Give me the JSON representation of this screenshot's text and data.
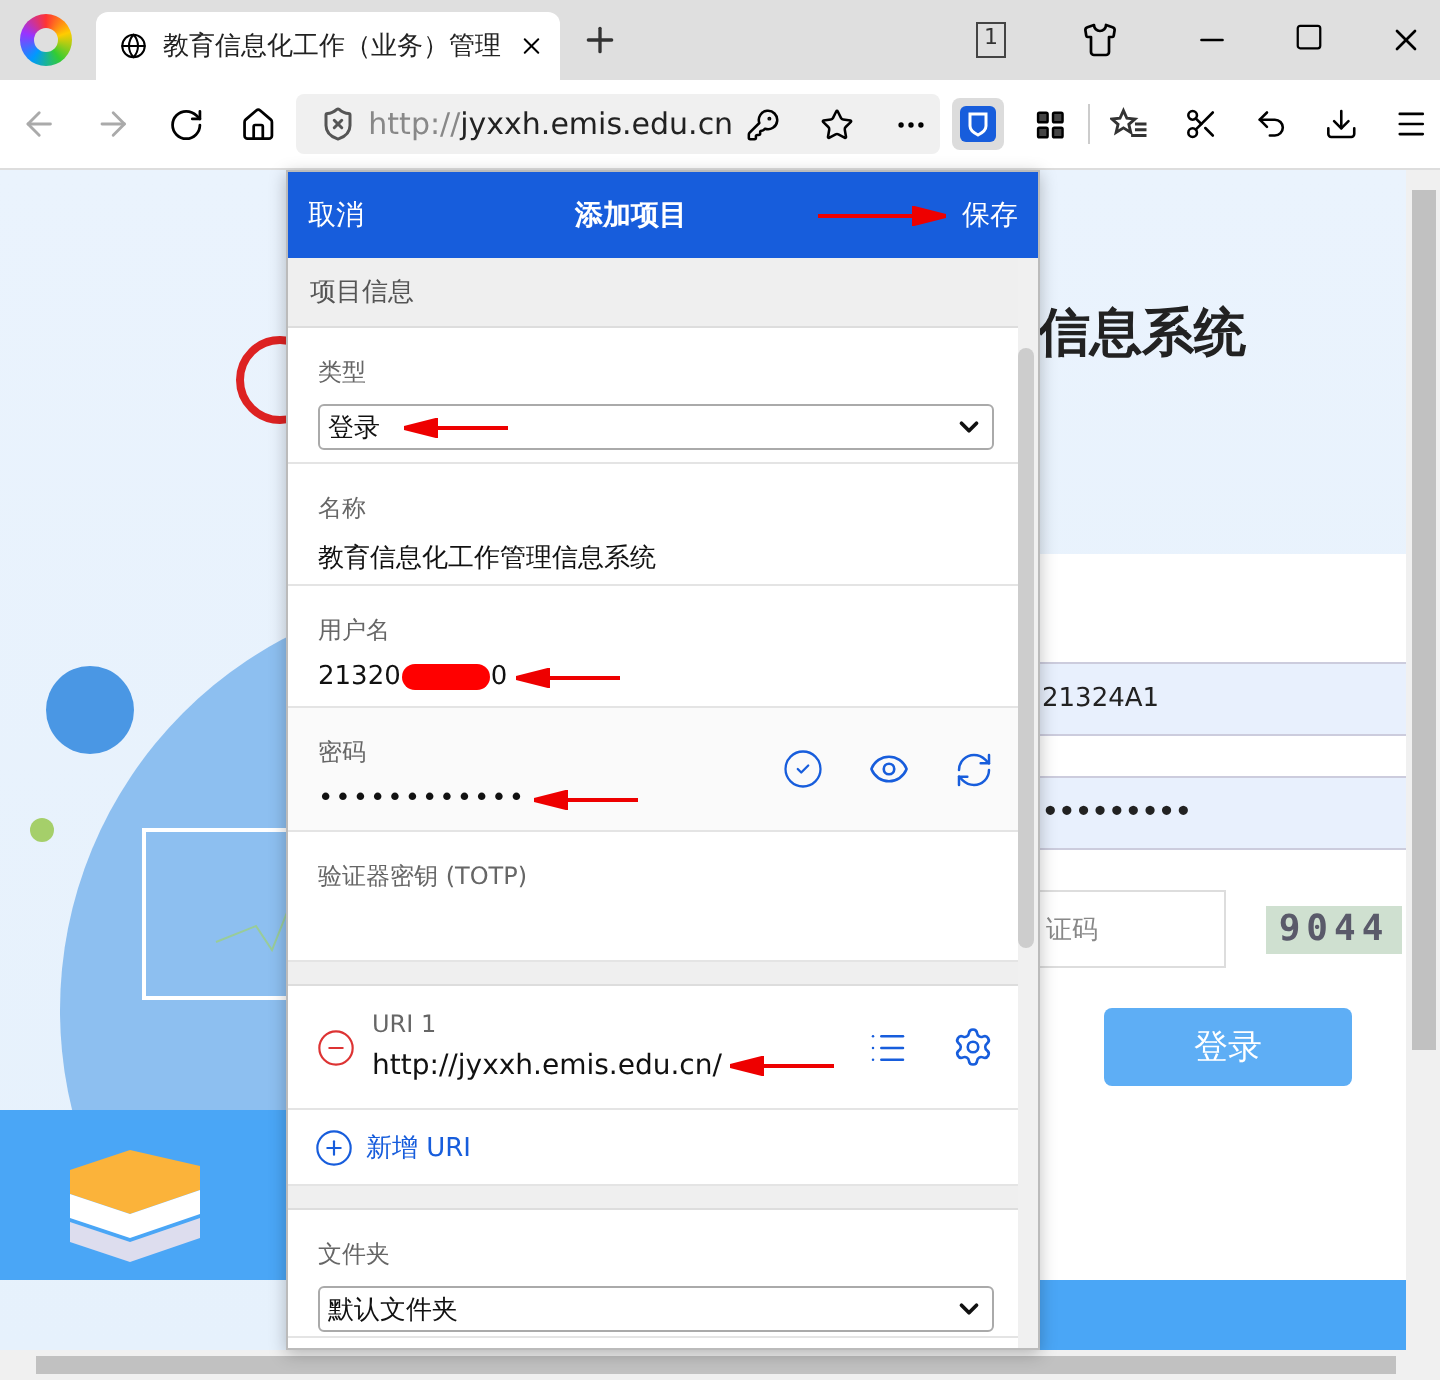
{
  "browser": {
    "tab_count": "1",
    "tab_title": "教育信息化工作（业务）管理",
    "url_scheme": "http://",
    "url_host": "jyxxh.emis.edu.cn"
  },
  "page": {
    "title_fragment": "信息系统",
    "username_value": "21324A1",
    "password_value": "•••••••••",
    "captcha_placeholder": "证码",
    "captcha_code": "9044",
    "login_button": "登录"
  },
  "popup": {
    "cancel": "取消",
    "title": "添加项目",
    "save": "保存",
    "save_annotated": true,
    "section": "项目信息",
    "fields": [
      {
        "kind": "select",
        "label": "类型",
        "value": "登录",
        "annotated": true
      },
      {
        "kind": "text",
        "label": "名称",
        "value": "教育信息化工作管理信息系统"
      },
      {
        "kind": "text",
        "label": "用户名",
        "value": "21320",
        "value_end": "0",
        "redacted": true,
        "annotated": true
      },
      {
        "kind": "password",
        "label": "密码",
        "value": "••••••••••••",
        "annotated": true
      },
      {
        "kind": "text",
        "label": "验证器密钥 (TOTP)"
      }
    ],
    "uris": [
      {
        "label": "URI 1",
        "value": "http://jyxxh.emis.edu.cn/",
        "annotated": true
      }
    ],
    "new_uri": "新增 URI",
    "folder": {
      "label": "文件夹",
      "value": "默认文件夹"
    }
  }
}
